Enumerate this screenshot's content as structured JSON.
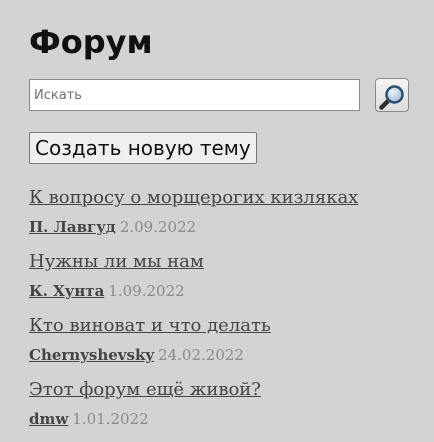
{
  "page": {
    "title": "Форум"
  },
  "search": {
    "placeholder": "Искать",
    "value": "",
    "button_icon": "search-icon"
  },
  "actions": {
    "create_topic_label": "Создать новую тему"
  },
  "topics": [
    {
      "title": "К вопросу о морщерогих кизляках",
      "author": "П. Лавгуд",
      "date": "2.09.2022"
    },
    {
      "title": "Нужны ли мы нам",
      "author": "К. Хунта",
      "date": "1.09.2022"
    },
    {
      "title": "Кто виноват и что делать",
      "author": "Chernyshevsky",
      "date": "24.02.2022"
    },
    {
      "title": "Этот форум ещё живой?",
      "author": "dmw",
      "date": "1.01.2022"
    }
  ],
  "colors": {
    "background": "#d3d3d3",
    "link": "#444444",
    "date": "#8a8a8a"
  }
}
